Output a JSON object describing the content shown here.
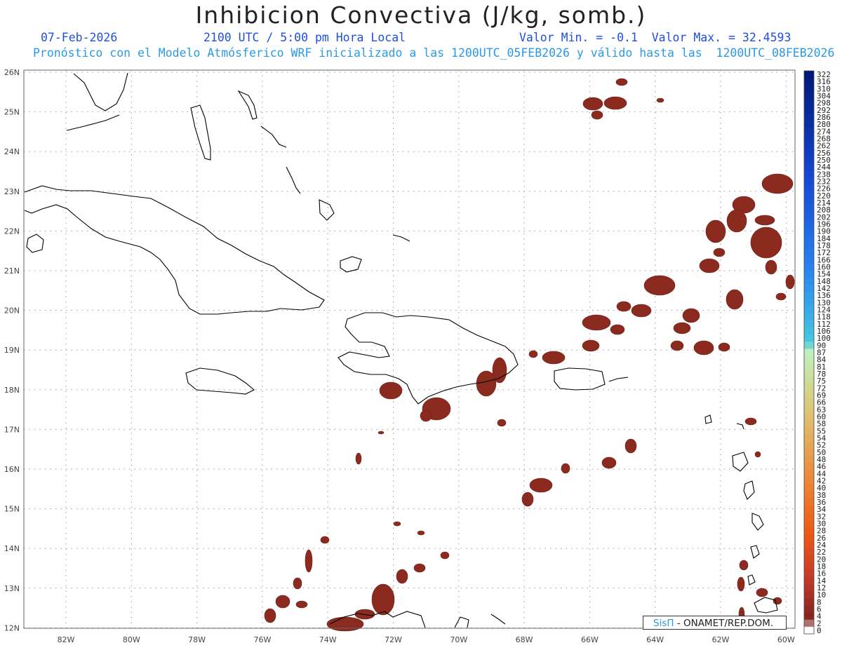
{
  "header": {
    "title": "Inhibicion Convectiva (J/kg, somb.)",
    "date": "07-Feb-2026",
    "time": "2100 UTC / 5:00 pm Hora Local",
    "minmax": "Valor Min. = -0.1  Valor Max. = 32.4593",
    "forecast": "Pronóstico con el Modelo Atmósferico WRF inicializado a las 1200UTC_05FEB2026 y válido hasta las  1200UTC_08FEB2026"
  },
  "map": {
    "lon_labels": [
      "82W",
      "80W",
      "78W",
      "76W",
      "74W",
      "72W",
      "70W",
      "68W",
      "66W",
      "64W",
      "62W",
      "60W"
    ],
    "lat_labels": [
      "26N",
      "25N",
      "24N",
      "23N",
      "22N",
      "21N",
      "20N",
      "19N",
      "18N",
      "17N",
      "16N",
      "15N",
      "14N",
      "13N",
      "12N"
    ],
    "fill_color": "#8b2a1f",
    "coast_color": "#000000",
    "grid_color": "#9a9a9a"
  },
  "colorbar": {
    "labels": [
      "322",
      "316",
      "310",
      "304",
      "298",
      "292",
      "286",
      "280",
      "274",
      "268",
      "262",
      "256",
      "250",
      "244",
      "238",
      "232",
      "226",
      "220",
      "214",
      "208",
      "202",
      "196",
      "190",
      "184",
      "178",
      "172",
      "166",
      "160",
      "154",
      "148",
      "142",
      "136",
      "130",
      "124",
      "118",
      "112",
      "106",
      "100",
      "90",
      "87",
      "84",
      "81",
      "78",
      "75",
      "72",
      "69",
      "66",
      "63",
      "60",
      "58",
      "55",
      "54",
      "52",
      "50",
      "48",
      "46",
      "44",
      "42",
      "40",
      "38",
      "36",
      "34",
      "32",
      "30",
      "28",
      "26",
      "24",
      "22",
      "20",
      "18",
      "16",
      "14",
      "12",
      "10",
      "8",
      "6",
      "4",
      "2",
      "0"
    ]
  },
  "credit": {
    "logo": "SisΠ",
    "text": " - ONAMET/REP.DOM."
  }
}
